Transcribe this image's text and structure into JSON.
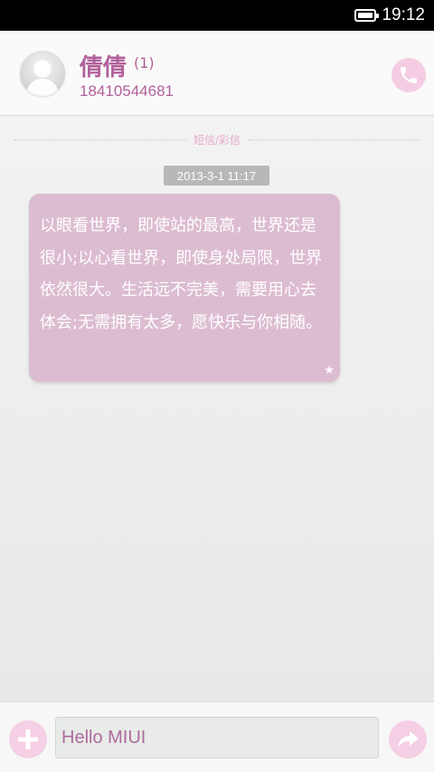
{
  "status_bar": {
    "time": "19:12",
    "battery_icon": "battery-full-icon"
  },
  "header": {
    "contact_name": "倩倩",
    "message_count": "(1)",
    "phone_number": "18410544681",
    "avatar_icon": "default-avatar-icon",
    "call_icon": "phone-icon"
  },
  "divider": {
    "label": "短信/彩信"
  },
  "conversation": {
    "timestamp": "2013-3-1 11:17",
    "messages": [
      {
        "text": "以眼看世界，即使站的最高，世界还是很小;以心看世界，即使身处局限，世界依然很大。生活远不完美，需要用心去体会;无需拥有太多，愿快乐与你相随。",
        "starred": true
      }
    ]
  },
  "composer": {
    "input_value": "Hello MIUI",
    "add_icon": "plus-icon",
    "send_icon": "send-arrow-icon"
  },
  "colors": {
    "accent": "#b0609a",
    "bubble": "#dcbcd0",
    "button_bg": "#f5cfe4"
  }
}
